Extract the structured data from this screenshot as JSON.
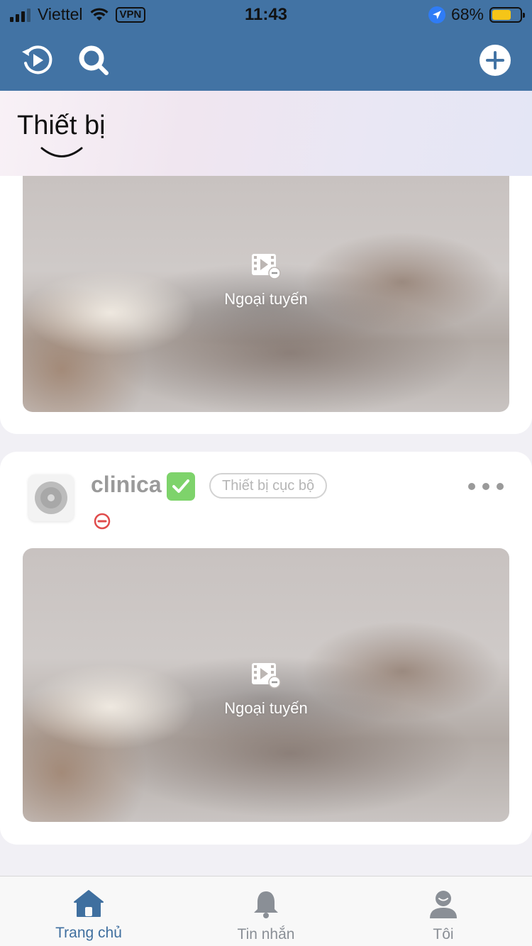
{
  "status_bar": {
    "carrier": "Viettel",
    "vpn": "VPN",
    "time": "11:43",
    "battery": "68%"
  },
  "toolbar": {
    "left_icons": [
      "history-play-icon",
      "search-icon"
    ],
    "right_icon": "add-icon"
  },
  "header": {
    "title": "Thiết bị"
  },
  "devices": [
    {
      "offline_label": "Ngoại tuyến"
    },
    {
      "name": "clinica",
      "tag": "Thiết bị cục bộ",
      "offline_label": "Ngoại tuyến"
    }
  ],
  "tabs": [
    {
      "label": "Trang chủ",
      "icon": "home-icon",
      "active": true
    },
    {
      "label": "Tin nhắn",
      "icon": "bell-icon",
      "active": false
    },
    {
      "label": "Tôi",
      "icon": "person-icon",
      "active": false
    }
  ],
  "colors": {
    "brand": "#4273a4",
    "tab_active": "#3f6f9f",
    "offline_red": "#e04b4b",
    "check_green": "#7ed36b"
  }
}
